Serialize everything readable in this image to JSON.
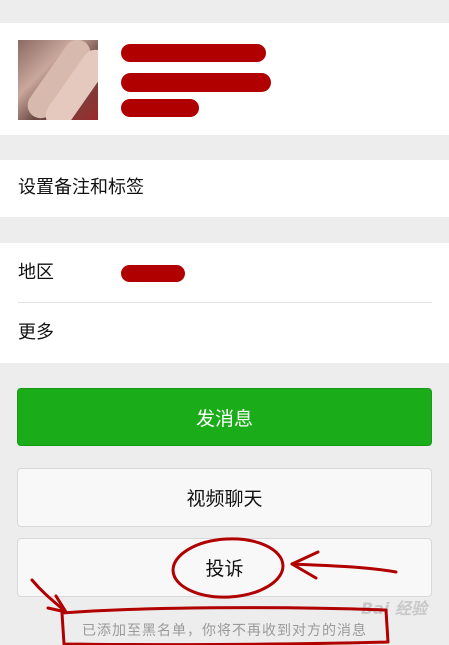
{
  "profile": {
    "avatar_icon": "user-avatar-photo"
  },
  "remark": {
    "label": "设置备注和标签"
  },
  "info": {
    "region_label": "地区",
    "more_label": "更多"
  },
  "actions": {
    "send_message": "发消息",
    "video_chat": "视频聊天",
    "report": "投诉"
  },
  "notice": {
    "blacklist_text": "已添加至黑名单，你将不再收到对方的消息"
  },
  "watermark": {
    "text": "Bai 经验"
  },
  "colors": {
    "primary_green": "#1aad19",
    "annotation_red": "#b10000",
    "background": "#ededed"
  }
}
